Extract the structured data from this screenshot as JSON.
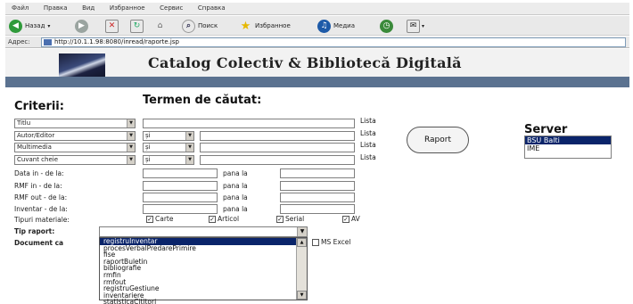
{
  "browser": {
    "menu": [
      "Файл",
      "Правка",
      "Вид",
      "Избранное",
      "Сервис",
      "Справка"
    ],
    "toolbar": {
      "back": "Назад",
      "search": "Поиск",
      "favorites": "Избранное",
      "media": "Медиа"
    },
    "address_label": "Адрес:",
    "address_value": "http://10.1.1.98:8080/inread/raporte.jsp"
  },
  "header": {
    "title": "Catalog Colectiv & Bibliotecă Digitală"
  },
  "form": {
    "criterii_label": "Criterii:",
    "termen_label": "Termen de căutat:",
    "criteria_rows": [
      {
        "field": "Titlu",
        "op": "",
        "lista": "Lista"
      },
      {
        "field": "Autor/Editor",
        "op": "și",
        "lista": "Lista"
      },
      {
        "field": "Multimedia",
        "op": "și",
        "lista": "Lista"
      },
      {
        "field": "Cuvant cheie",
        "op": "și",
        "lista": "Lista"
      }
    ],
    "raport_button": "Raport",
    "date_rows": [
      {
        "label": "Data in - de la:",
        "to": "pana la"
      },
      {
        "label": "RMF in - de la:",
        "to": "pana la"
      },
      {
        "label": "RMF out - de la:",
        "to": "pana la"
      },
      {
        "label": "Inventar - de la:",
        "to": "pana la"
      }
    ],
    "tipuri_label": "Tipuri materiale:",
    "tipuri": [
      "Carte",
      "Articol",
      "Serial",
      "AV"
    ],
    "tip_raport_label": "Tip raport:",
    "document_label": "Document ca",
    "excel_label": "MS Excel",
    "tip_raport_options": [
      "registruInventar",
      "procesVerbalPredarePrimire",
      "fise",
      "raportBuletin",
      "bibliografie",
      "rmfin",
      "rmfout",
      "registruGestiune",
      "inventariere",
      "statisticaCititori"
    ]
  },
  "server": {
    "label": "Server",
    "options": [
      "BSU Balti",
      "IME"
    ],
    "selected": "BSU Balti"
  }
}
